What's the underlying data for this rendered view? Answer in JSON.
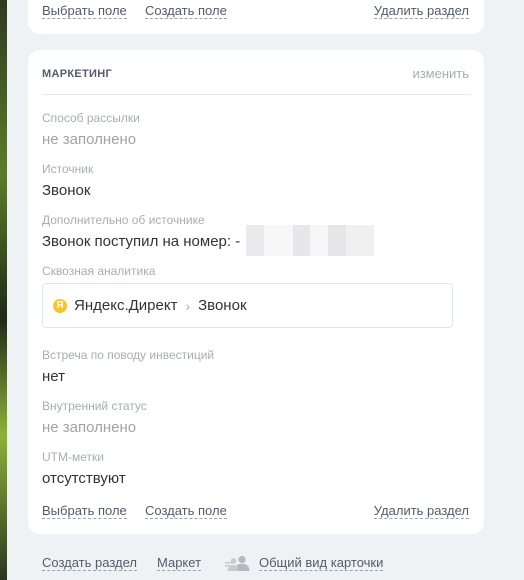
{
  "top_section": {
    "select_field": "Выбрать поле",
    "create_field": "Создать поле",
    "delete_section": "Удалить раздел"
  },
  "marketing": {
    "title": "МАРКЕТИНГ",
    "edit": "изменить",
    "fields": [
      {
        "label": "Способ рассылки",
        "value": "не заполнено"
      },
      {
        "label": "Источник",
        "value": "Звонок"
      },
      {
        "label": "Дополнительно об источнике",
        "value": "Звонок поступил на номер: -"
      },
      {
        "label": "Сквозная аналитика",
        "value": ""
      },
      {
        "label": "Встреча по поводу инвестиций",
        "value": "нет"
      },
      {
        "label": "Внутренний статус",
        "value": "не заполнено"
      },
      {
        "label": "UTM-метки",
        "value": "отсутствуют"
      }
    ],
    "analytics": {
      "icon_letter": "Я",
      "source": "Яндекс.Директ",
      "separator": "›",
      "channel": "Звонок"
    },
    "select_field": "Выбрать поле",
    "create_field": "Создать поле",
    "delete_section": "Удалить раздел"
  },
  "footer": {
    "create_section": "Создать раздел",
    "market": "Маркет",
    "general_view": "Общий вид карточки"
  },
  "colors": {
    "background": "#eef2f4",
    "accent_yandex": "#f6c42f"
  }
}
